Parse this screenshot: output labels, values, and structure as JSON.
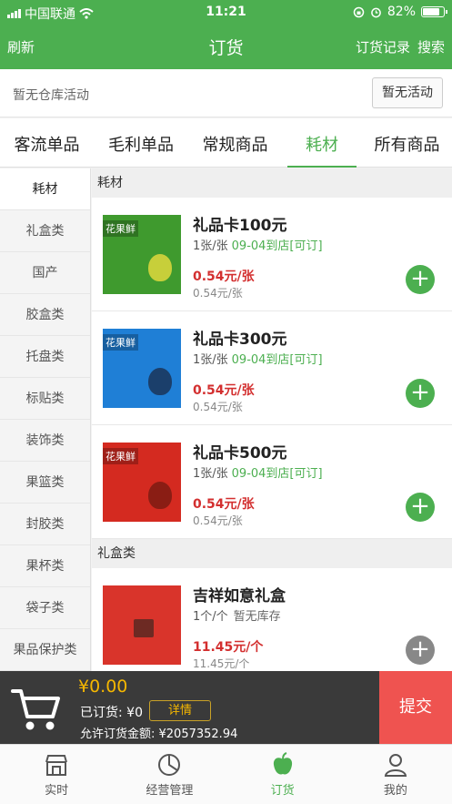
{
  "status": {
    "carrier": "中国联通",
    "time": "11:21",
    "battery": "82%",
    "battery_level": 0.82
  },
  "nav": {
    "left": "刷新",
    "title": "订货",
    "record": "订货记录",
    "search": "搜索"
  },
  "activity": {
    "text": "暂无仓库活动",
    "button": "暂无活动"
  },
  "tabs": [
    {
      "label": "客流单品"
    },
    {
      "label": "毛利单品"
    },
    {
      "label": "常规商品"
    },
    {
      "label": "耗材"
    },
    {
      "label": "所有商品"
    }
  ],
  "active_tab": "耗材",
  "sidebar": {
    "items": [
      {
        "label": "耗材"
      },
      {
        "label": "礼盒类"
      },
      {
        "label": "国产"
      },
      {
        "label": "胶盒类"
      },
      {
        "label": "托盘类"
      },
      {
        "label": "标贴类"
      },
      {
        "label": "装饰类"
      },
      {
        "label": "果篮类"
      },
      {
        "label": "封胶类"
      },
      {
        "label": "果杯类"
      },
      {
        "label": "袋子类"
      },
      {
        "label": "果品保护类"
      }
    ]
  },
  "sections": [
    {
      "title": "耗材",
      "products": [
        {
          "name": "礼品卡100元",
          "spec": "1张/张",
          "availability": "09-04到店[可订]",
          "price": "0.54元/张",
          "orig_price": "0.54元/张",
          "brand": "花果鲜",
          "color": "#3f9a2e",
          "mascot_color": "#c7cf3a"
        },
        {
          "name": "礼品卡300元",
          "spec": "1张/张",
          "availability": "09-04到店[可订]",
          "price": "0.54元/张",
          "orig_price": "0.54元/张",
          "brand": "花果鲜",
          "color": "#1f7fd6",
          "mascot_color": "#1b3f6b"
        },
        {
          "name": "礼品卡500元",
          "spec": "1张/张",
          "availability": "09-04到店[可订]",
          "price": "0.54元/张",
          "orig_price": "0.54元/张",
          "brand": "花果鲜",
          "color": "#d42a20",
          "mascot_color": "#8a1d14"
        }
      ]
    },
    {
      "title": "礼盒类",
      "products": [
        {
          "name": "吉祥如意礼盒",
          "spec": "1个/个",
          "availability": "暂无库存",
          "price": "11.45元/个",
          "orig_price": "11.45元/个",
          "brand": "",
          "color": "#d9342b",
          "mascot_color": "#6d2a23"
        }
      ]
    }
  ],
  "cart": {
    "total": "¥0.00",
    "ordered": "已订货: ¥0",
    "detail": "详情",
    "allowed": "允许订货金额: ¥2057352.94",
    "submit": "提交"
  },
  "tabbar": [
    {
      "label": "实时",
      "icon": "store-icon"
    },
    {
      "label": "经营管理",
      "icon": "pie-chart-icon"
    },
    {
      "label": "订货",
      "icon": "apple-icon"
    },
    {
      "label": "我的",
      "icon": "user-icon"
    }
  ],
  "active_tabbar": "订货",
  "colors": {
    "primary": "#4caf50",
    "price": "#d32f2f",
    "submit": "#ef5350",
    "cart_total": "#f5b700"
  }
}
